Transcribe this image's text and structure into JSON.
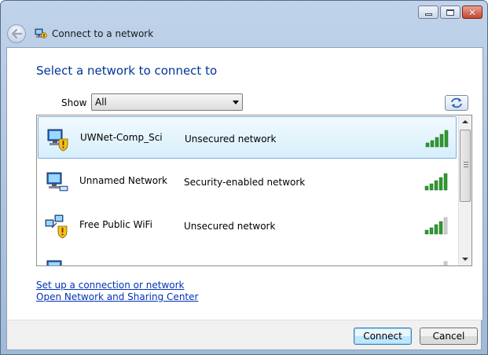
{
  "window": {
    "title": "Connect to a network",
    "caption_buttons": {
      "minimize_icon": "minimize-icon",
      "maximize_icon": "maximize-icon",
      "close_glyph": "✕"
    }
  },
  "content": {
    "heading": "Select a network to connect to",
    "filter": {
      "label": "Show",
      "value": "All"
    },
    "networks": [
      {
        "name": "UWNet-Comp_Sci",
        "security": "Unsecured network",
        "secured": false,
        "signal_bars": 5,
        "selected": true
      },
      {
        "name": "Unnamed Network",
        "security": "Security-enabled network",
        "secured": true,
        "signal_bars": 5,
        "selected": false
      },
      {
        "name": "Free Public WiFi",
        "security": "Unsecured network",
        "secured": false,
        "signal_bars": 4,
        "selected": false,
        "adhoc": true
      }
    ],
    "links": {
      "setup": "Set up a connection or network",
      "sharing_center": "Open Network and Sharing Center"
    }
  },
  "footer": {
    "connect_label": "Connect",
    "cancel_label": "Cancel"
  },
  "colors": {
    "heading": "#003399",
    "link": "#0033bb",
    "signal_green": "#2e9a2e",
    "selection_border": "#84acdd"
  }
}
